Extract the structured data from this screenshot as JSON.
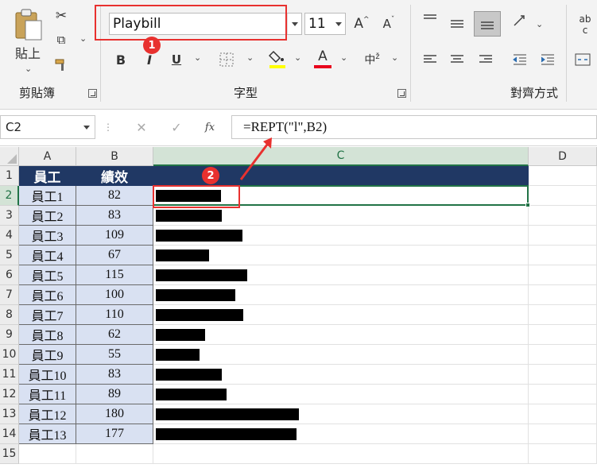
{
  "ribbon": {
    "clipboard": {
      "paste_label": "貼上",
      "group_label": "剪貼簿"
    },
    "font": {
      "font_name": "Playbill",
      "font_size": "11",
      "bold": "B",
      "italic": "I",
      "underline": "U",
      "font_color_letter": "A",
      "grow_font": "A",
      "shrink_font": "A",
      "phonetic": "中",
      "group_label": "字型"
    },
    "alignment": {
      "group_label": "對齊方式",
      "wrap_text": "ab",
      "wrap_text_2": "c"
    },
    "accent": "#e8312f"
  },
  "annotations": {
    "badge1": "1",
    "badge2": "2"
  },
  "formula_bar": {
    "name_box": "C2",
    "fx_label": "fx",
    "formula": "=REPT(\"l\",B2)"
  },
  "sheet": {
    "columns": [
      "A",
      "B",
      "C",
      "D"
    ],
    "rows": [
      "1",
      "2",
      "3",
      "4",
      "5",
      "6",
      "7",
      "8",
      "9",
      "10",
      "11",
      "12",
      "13",
      "14",
      "15"
    ],
    "header": {
      "a": "員工",
      "b": "績效"
    },
    "data": [
      {
        "name": "員工1",
        "score": "82",
        "bar": 82
      },
      {
        "name": "員工2",
        "score": "83",
        "bar": 83
      },
      {
        "name": "員工3",
        "score": "109",
        "bar": 109
      },
      {
        "name": "員工4",
        "score": "67",
        "bar": 67
      },
      {
        "name": "員工5",
        "score": "115",
        "bar": 115
      },
      {
        "name": "員工6",
        "score": "100",
        "bar": 100
      },
      {
        "name": "員工7",
        "score": "110",
        "bar": 110
      },
      {
        "name": "員工8",
        "score": "62",
        "bar": 62
      },
      {
        "name": "員工9",
        "score": "55",
        "bar": 55
      },
      {
        "name": "員工10",
        "score": "83",
        "bar": 83
      },
      {
        "name": "員工11",
        "score": "89",
        "bar": 89
      },
      {
        "name": "員工12",
        "score": "180",
        "bar": 180
      },
      {
        "name": "員工13",
        "score": "177",
        "bar": 177
      }
    ],
    "header_fill": "#203864",
    "data_fill": "#d9e1f2",
    "select_color": "#217346"
  }
}
